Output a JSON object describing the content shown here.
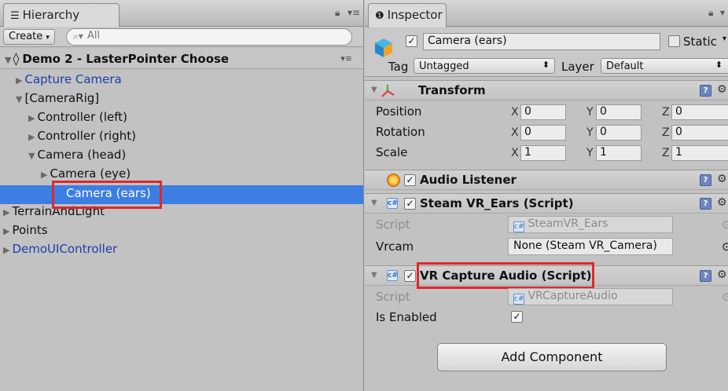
{
  "hierarchy": {
    "tab_title": "Hierarchy",
    "create_label": "Create",
    "search_placeholder": "All",
    "scene_name": "Demo 2 - LasterPointer Choose",
    "items": [
      {
        "label": "Capture Camera"
      },
      {
        "label": "[CameraRig]"
      },
      {
        "label": "Controller (left)"
      },
      {
        "label": "Controller (right)"
      },
      {
        "label": "Camera (head)"
      },
      {
        "label": "Camera (eye)"
      },
      {
        "label": "Camera (ears)"
      },
      {
        "label": "TerrainAndLight"
      },
      {
        "label": "Points"
      },
      {
        "label": "DemoUIController"
      }
    ]
  },
  "inspector": {
    "tab_title": "Inspector",
    "object_name": "Camera (ears)",
    "static_label": "Static",
    "tag_label": "Tag",
    "tag_value": "Untagged",
    "layer_label": "Layer",
    "layer_value": "Default",
    "transform": {
      "title": "Transform",
      "rows": [
        {
          "label": "Position",
          "x": "0",
          "y": "0",
          "z": "0"
        },
        {
          "label": "Rotation",
          "x": "0",
          "y": "0",
          "z": "0"
        },
        {
          "label": "Scale",
          "x": "1",
          "y": "1",
          "z": "1"
        }
      ],
      "axis_x": "X",
      "axis_y": "Y",
      "axis_z": "Z"
    },
    "audio_listener": {
      "title": "Audio Listener"
    },
    "steam_ears": {
      "title": "Steam VR_Ears (Script)",
      "script_label": "Script",
      "script_value": "SteamVR_Ears",
      "vrcam_label": "Vrcam",
      "vrcam_value": "None (Steam VR_Camera)"
    },
    "vr_capture": {
      "title": "VR Capture Audio (Script)",
      "script_label": "Script",
      "script_value": "VRCaptureAudio",
      "enabled_label": "Is Enabled"
    },
    "add_component": "Add Component"
  },
  "colors": {
    "selection": "#3c7ee2",
    "highlight_box": "#e0272c",
    "prefab_text": "#1b3ea8"
  }
}
